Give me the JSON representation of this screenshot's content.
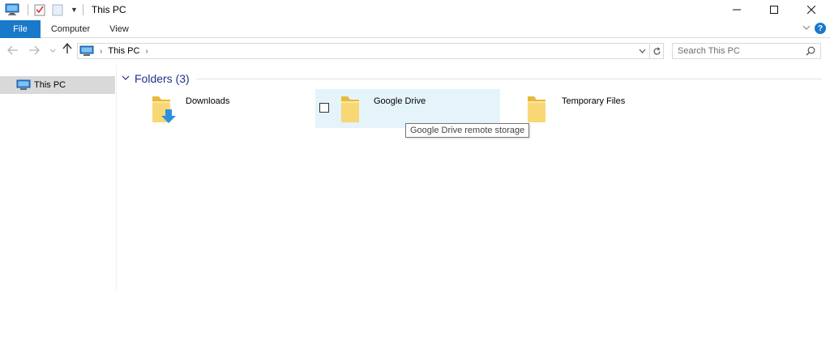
{
  "window": {
    "title": "This PC",
    "controls": {
      "minimize_icon": "minimize-icon",
      "maximize_icon": "maximize-icon",
      "close_icon": "close-icon"
    }
  },
  "quick_access_toolbar": {
    "icons": [
      "this-pc-icon",
      "properties-icon",
      "new-folder-icon",
      "customize-dropdown-icon"
    ]
  },
  "ribbon": {
    "tabs": [
      {
        "label": "File",
        "active": true
      },
      {
        "label": "Computer"
      },
      {
        "label": "View"
      }
    ],
    "help_label": "?"
  },
  "navigation": {
    "address_crumb": "This PC",
    "search_placeholder": "Search This PC"
  },
  "nav_pane": {
    "items": [
      {
        "label": "This PC",
        "selected": true
      }
    ]
  },
  "content": {
    "group_title": "Folders (3)",
    "folders": [
      {
        "name": "Downloads",
        "icon": "downloads-folder-icon"
      },
      {
        "name": "Google Drive",
        "icon": "folder-icon",
        "hovered": true
      },
      {
        "name": "Temporary Files",
        "icon": "folder-icon"
      }
    ],
    "tooltip": "Google Drive remote storage"
  },
  "colors": {
    "accent": "#1979ca",
    "group_header": "#1e3287",
    "hover_tile": "#e5f3fb",
    "selected_nav": "#d9d9d9",
    "folder_yellow": "#f8d775",
    "download_arrow": "#2f8fe0"
  }
}
